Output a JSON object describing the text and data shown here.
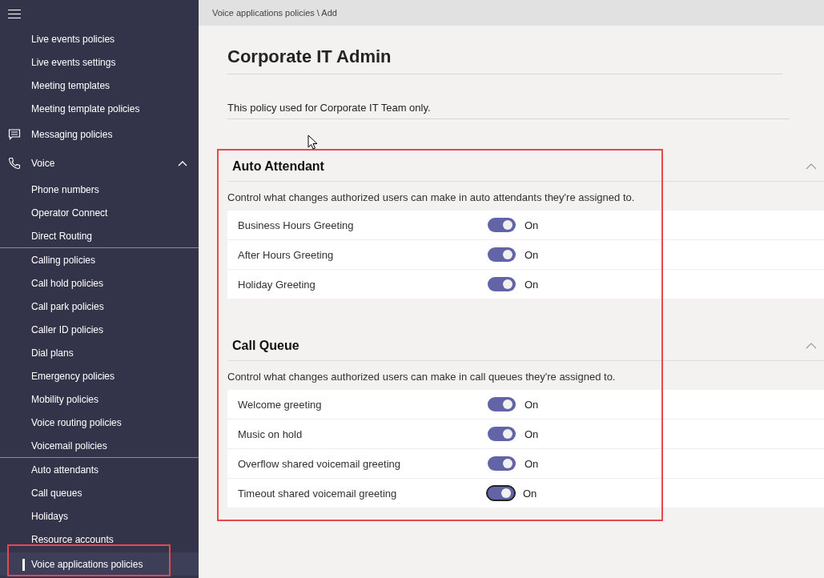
{
  "sidebar": {
    "groups": [
      {
        "items": [
          {
            "kind": "link",
            "label": "Live events policies",
            "selected": false
          },
          {
            "kind": "link",
            "label": "Live events settings",
            "selected": false
          },
          {
            "kind": "link",
            "label": "Meeting templates",
            "selected": false
          },
          {
            "kind": "link",
            "label": "Meeting template policies",
            "selected": false
          },
          {
            "kind": "chat",
            "label": "Messaging policies",
            "selected": false
          },
          {
            "kind": "phone",
            "label": "Voice",
            "selected": false,
            "expanded": true
          },
          {
            "kind": "link",
            "label": "Phone numbers",
            "selected": false
          },
          {
            "kind": "link",
            "label": "Operator Connect",
            "selected": false
          },
          {
            "kind": "link",
            "label": "Direct Routing",
            "selected": false
          }
        ]
      },
      {
        "items": [
          {
            "kind": "link",
            "label": "Calling policies",
            "selected": false
          },
          {
            "kind": "link",
            "label": "Call hold policies",
            "selected": false
          },
          {
            "kind": "link",
            "label": "Call park policies",
            "selected": false
          },
          {
            "kind": "link",
            "label": "Caller ID policies",
            "selected": false
          },
          {
            "kind": "link",
            "label": "Dial plans",
            "selected": false
          },
          {
            "kind": "link",
            "label": "Emergency policies",
            "selected": false
          },
          {
            "kind": "link",
            "label": "Mobility policies",
            "selected": false
          },
          {
            "kind": "link",
            "label": "Voice routing policies",
            "selected": false
          },
          {
            "kind": "link",
            "label": "Voicemail policies",
            "selected": false
          }
        ]
      },
      {
        "items": [
          {
            "kind": "link",
            "label": "Auto attendants",
            "selected": false
          },
          {
            "kind": "link",
            "label": "Call queues",
            "selected": false
          },
          {
            "kind": "link",
            "label": "Holidays",
            "selected": false
          },
          {
            "kind": "link",
            "label": "Resource accounts",
            "selected": false
          },
          {
            "kind": "link",
            "label": "Voice applications policies",
            "selected": true
          }
        ]
      }
    ]
  },
  "breadcrumb": "Voice applications policies \\ Add",
  "title": "Corporate IT Admin",
  "description": "This policy used for Corporate IT Team only.",
  "sections": [
    {
      "title": "Auto Attendant",
      "expanded": true,
      "description": "Control what changes authorized users can make in auto attendants they're assigned to.",
      "settings": [
        {
          "label": "Business Hours Greeting",
          "on": true,
          "state": "On",
          "focused": false
        },
        {
          "label": "After Hours Greeting",
          "on": true,
          "state": "On",
          "focused": false
        },
        {
          "label": "Holiday Greeting",
          "on": true,
          "state": "On",
          "focused": false
        }
      ]
    },
    {
      "title": "Call Queue",
      "expanded": true,
      "description": "Control what changes authorized users can make in call queues they're assigned to.",
      "settings": [
        {
          "label": "Welcome greeting",
          "on": true,
          "state": "On",
          "focused": false
        },
        {
          "label": "Music on hold",
          "on": true,
          "state": "On",
          "focused": false
        },
        {
          "label": "Overflow shared voicemail greeting",
          "on": true,
          "state": "On",
          "focused": false
        },
        {
          "label": "Timeout shared voicemail greeting",
          "on": true,
          "state": "On",
          "focused": true
        }
      ]
    }
  ]
}
